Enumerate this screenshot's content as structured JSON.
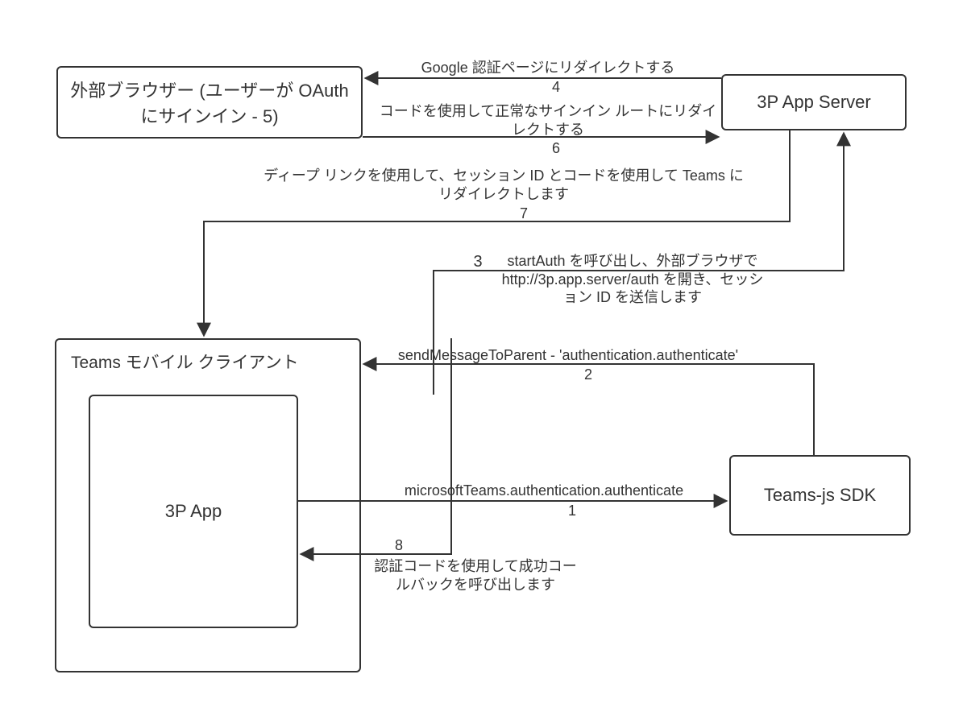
{
  "nodes": {
    "external_browser": "外部ブラウザー (ユーザーが OAuth にサインイン - 5)",
    "server": "3P App Server",
    "teams_mobile": "Teams モバイル クライアント",
    "app": "3P App",
    "sdk": "Teams-js SDK"
  },
  "edges": {
    "e4_label": "Google 認証ページにリダイレクトする",
    "e4_num": "4",
    "e6_label": "コードを使用して正常なサインイン ルートにリダイレクトする",
    "e6_num": "6",
    "e7_label": "ディープ リンクを使用して、セッション ID とコードを使用して Teams にリダイレクトします",
    "e7_num": "7",
    "e3_num": "3",
    "e3_label": "startAuth を呼び出し、外部ブラウザで http://3p.app.server/auth を開き、セッション ID を送信します",
    "e2_label": "sendMessageToParent - 'authentication.authenticate'",
    "e2_num": "2",
    "e1_label": "microsoftTeams.authentication.authenticate",
    "e1_num": "1",
    "e8_num": "8",
    "e8_label": "認証コードを使用して成功コールバックを呼び出します"
  }
}
